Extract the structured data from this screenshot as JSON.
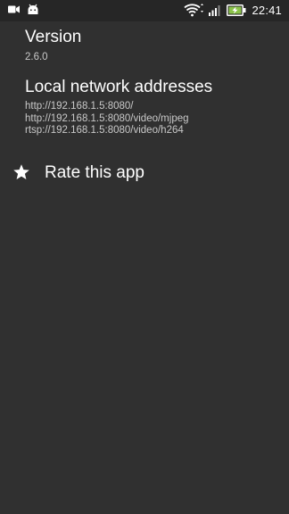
{
  "status_bar": {
    "time": "22:41",
    "icons": [
      "video-camera-icon",
      "android-icon",
      "wifi-icon",
      "signal-icon",
      "battery-charging-icon"
    ]
  },
  "version": {
    "title": "Version",
    "value": "2.6.0"
  },
  "network": {
    "title": "Local network addresses",
    "addresses": [
      "http://192.168.1.5:8080/",
      "http://192.168.1.5:8080/video/mjpeg",
      "rtsp://192.168.1.5:8080/video/h264"
    ]
  },
  "rate": {
    "label": "Rate this app",
    "icon": "star-icon"
  },
  "colors": {
    "background": "#303030",
    "status_bar": "#262626",
    "battery_accent": "#8bc34a"
  }
}
